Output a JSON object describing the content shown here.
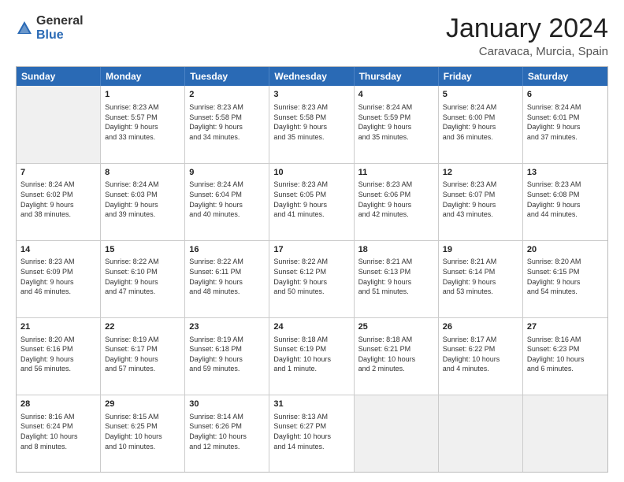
{
  "header": {
    "logo_general": "General",
    "logo_blue": "Blue",
    "title": "January 2024",
    "subtitle": "Caravaca, Murcia, Spain"
  },
  "calendar": {
    "days_of_week": [
      "Sunday",
      "Monday",
      "Tuesday",
      "Wednesday",
      "Thursday",
      "Friday",
      "Saturday"
    ],
    "rows": [
      [
        {
          "day": "",
          "text": ""
        },
        {
          "day": "1",
          "text": "Sunrise: 8:23 AM\nSunset: 5:57 PM\nDaylight: 9 hours\nand 33 minutes."
        },
        {
          "day": "2",
          "text": "Sunrise: 8:23 AM\nSunset: 5:58 PM\nDaylight: 9 hours\nand 34 minutes."
        },
        {
          "day": "3",
          "text": "Sunrise: 8:23 AM\nSunset: 5:58 PM\nDaylight: 9 hours\nand 35 minutes."
        },
        {
          "day": "4",
          "text": "Sunrise: 8:24 AM\nSunset: 5:59 PM\nDaylight: 9 hours\nand 35 minutes."
        },
        {
          "day": "5",
          "text": "Sunrise: 8:24 AM\nSunset: 6:00 PM\nDaylight: 9 hours\nand 36 minutes."
        },
        {
          "day": "6",
          "text": "Sunrise: 8:24 AM\nSunset: 6:01 PM\nDaylight: 9 hours\nand 37 minutes."
        }
      ],
      [
        {
          "day": "7",
          "text": "Sunrise: 8:24 AM\nSunset: 6:02 PM\nDaylight: 9 hours\nand 38 minutes."
        },
        {
          "day": "8",
          "text": "Sunrise: 8:24 AM\nSunset: 6:03 PM\nDaylight: 9 hours\nand 39 minutes."
        },
        {
          "day": "9",
          "text": "Sunrise: 8:24 AM\nSunset: 6:04 PM\nDaylight: 9 hours\nand 40 minutes."
        },
        {
          "day": "10",
          "text": "Sunrise: 8:23 AM\nSunset: 6:05 PM\nDaylight: 9 hours\nand 41 minutes."
        },
        {
          "day": "11",
          "text": "Sunrise: 8:23 AM\nSunset: 6:06 PM\nDaylight: 9 hours\nand 42 minutes."
        },
        {
          "day": "12",
          "text": "Sunrise: 8:23 AM\nSunset: 6:07 PM\nDaylight: 9 hours\nand 43 minutes."
        },
        {
          "day": "13",
          "text": "Sunrise: 8:23 AM\nSunset: 6:08 PM\nDaylight: 9 hours\nand 44 minutes."
        }
      ],
      [
        {
          "day": "14",
          "text": "Sunrise: 8:23 AM\nSunset: 6:09 PM\nDaylight: 9 hours\nand 46 minutes."
        },
        {
          "day": "15",
          "text": "Sunrise: 8:22 AM\nSunset: 6:10 PM\nDaylight: 9 hours\nand 47 minutes."
        },
        {
          "day": "16",
          "text": "Sunrise: 8:22 AM\nSunset: 6:11 PM\nDaylight: 9 hours\nand 48 minutes."
        },
        {
          "day": "17",
          "text": "Sunrise: 8:22 AM\nSunset: 6:12 PM\nDaylight: 9 hours\nand 50 minutes."
        },
        {
          "day": "18",
          "text": "Sunrise: 8:21 AM\nSunset: 6:13 PM\nDaylight: 9 hours\nand 51 minutes."
        },
        {
          "day": "19",
          "text": "Sunrise: 8:21 AM\nSunset: 6:14 PM\nDaylight: 9 hours\nand 53 minutes."
        },
        {
          "day": "20",
          "text": "Sunrise: 8:20 AM\nSunset: 6:15 PM\nDaylight: 9 hours\nand 54 minutes."
        }
      ],
      [
        {
          "day": "21",
          "text": "Sunrise: 8:20 AM\nSunset: 6:16 PM\nDaylight: 9 hours\nand 56 minutes."
        },
        {
          "day": "22",
          "text": "Sunrise: 8:19 AM\nSunset: 6:17 PM\nDaylight: 9 hours\nand 57 minutes."
        },
        {
          "day": "23",
          "text": "Sunrise: 8:19 AM\nSunset: 6:18 PM\nDaylight: 9 hours\nand 59 minutes."
        },
        {
          "day": "24",
          "text": "Sunrise: 8:18 AM\nSunset: 6:19 PM\nDaylight: 10 hours\nand 1 minute."
        },
        {
          "day": "25",
          "text": "Sunrise: 8:18 AM\nSunset: 6:21 PM\nDaylight: 10 hours\nand 2 minutes."
        },
        {
          "day": "26",
          "text": "Sunrise: 8:17 AM\nSunset: 6:22 PM\nDaylight: 10 hours\nand 4 minutes."
        },
        {
          "day": "27",
          "text": "Sunrise: 8:16 AM\nSunset: 6:23 PM\nDaylight: 10 hours\nand 6 minutes."
        }
      ],
      [
        {
          "day": "28",
          "text": "Sunrise: 8:16 AM\nSunset: 6:24 PM\nDaylight: 10 hours\nand 8 minutes."
        },
        {
          "day": "29",
          "text": "Sunrise: 8:15 AM\nSunset: 6:25 PM\nDaylight: 10 hours\nand 10 minutes."
        },
        {
          "day": "30",
          "text": "Sunrise: 8:14 AM\nSunset: 6:26 PM\nDaylight: 10 hours\nand 12 minutes."
        },
        {
          "day": "31",
          "text": "Sunrise: 8:13 AM\nSunset: 6:27 PM\nDaylight: 10 hours\nand 14 minutes."
        },
        {
          "day": "",
          "text": ""
        },
        {
          "day": "",
          "text": ""
        },
        {
          "day": "",
          "text": ""
        }
      ]
    ]
  }
}
